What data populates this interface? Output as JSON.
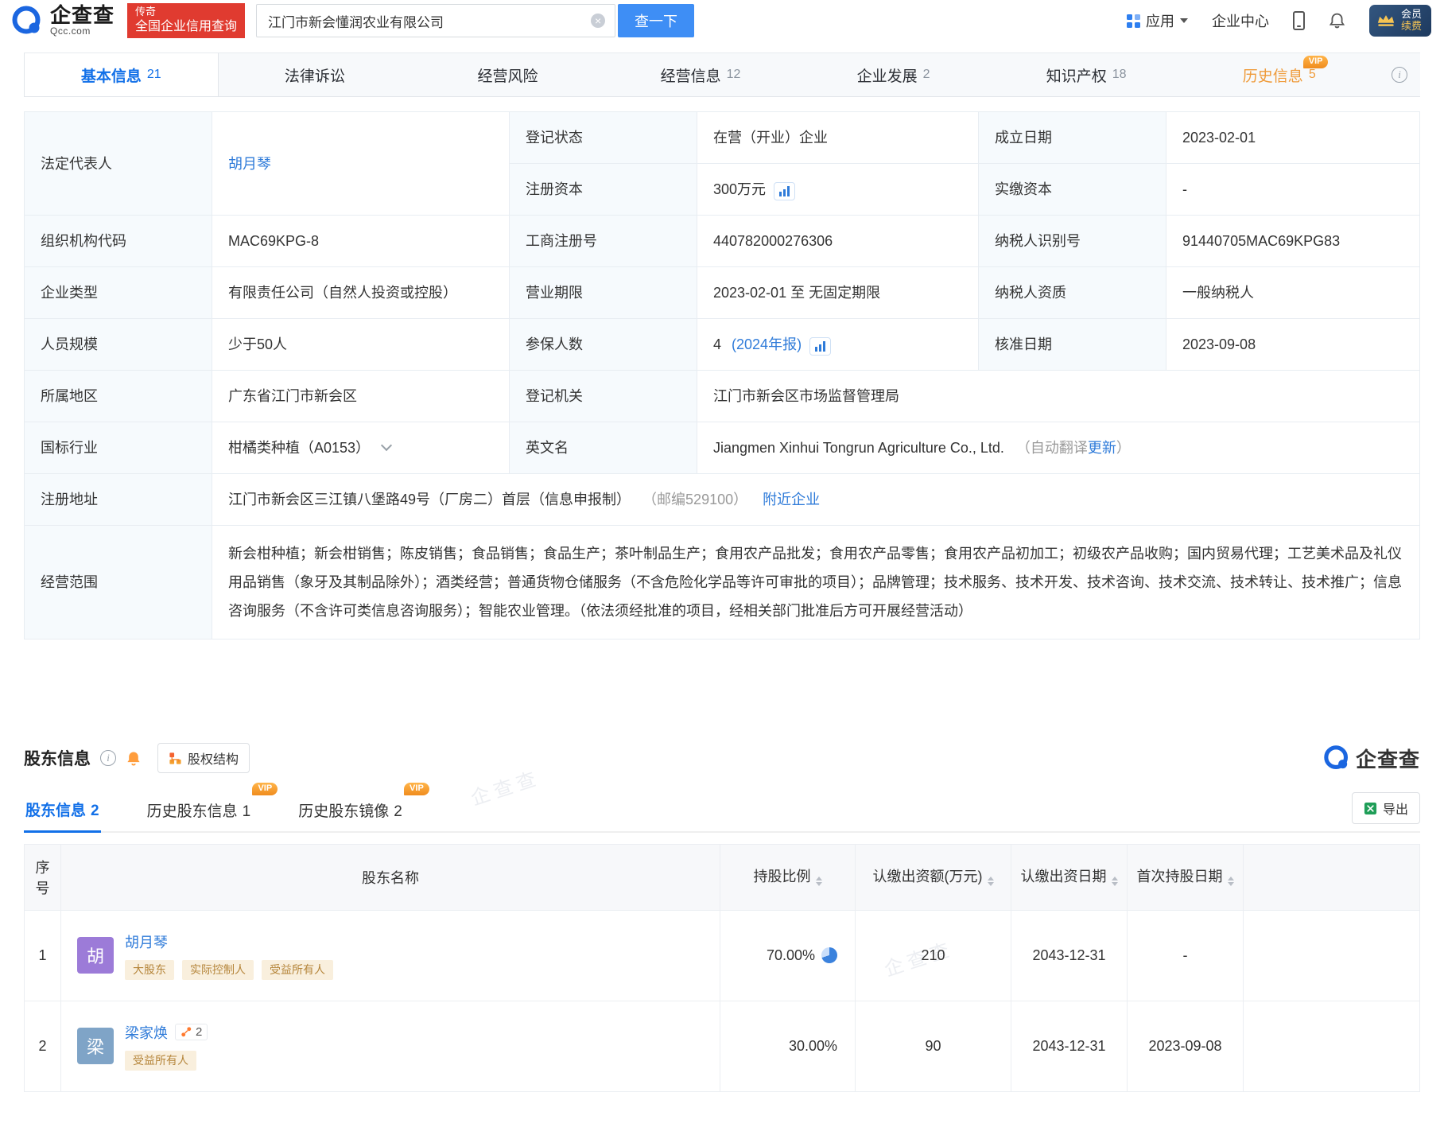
{
  "header": {
    "brand": {
      "name": "企查查",
      "domain": "Qcc.com"
    },
    "promo": {
      "line1": "传奇",
      "line2": "全国企业信用查询"
    },
    "search": {
      "value": "江门市新会懂润农业有限公司",
      "button": "查一下"
    },
    "nav": {
      "apps": "应用",
      "enterprise_center": "企业中心",
      "vip_top": "会员",
      "vip_bottom": "续费"
    }
  },
  "tabs": [
    {
      "label": "基本信息",
      "count": "21"
    },
    {
      "label": "法律诉讼",
      "count": ""
    },
    {
      "label": "经营风险",
      "count": ""
    },
    {
      "label": "经营信息",
      "count": "12"
    },
    {
      "label": "企业发展",
      "count": "2"
    },
    {
      "label": "知识产权",
      "count": "18"
    },
    {
      "label": "历史信息",
      "count": "5",
      "vip": "VIP"
    }
  ],
  "info": {
    "legal_rep": {
      "label": "法定代表人",
      "value": "胡月琴"
    },
    "reg_status": {
      "label": "登记状态",
      "value": "在营（开业）企业"
    },
    "est_date": {
      "label": "成立日期",
      "value": "2023-02-01"
    },
    "reg_capital": {
      "label": "注册资本",
      "value": "300万元"
    },
    "paid_capital": {
      "label": "实缴资本",
      "value": "-"
    },
    "org_code": {
      "label": "组织机构代码",
      "value": "MAC69KPG-8"
    },
    "reg_no": {
      "label": "工商注册号",
      "value": "440782000276306"
    },
    "taxpayer_id": {
      "label": "纳税人识别号",
      "value": "91440705MAC69KPG83"
    },
    "company_type": {
      "label": "企业类型",
      "value": "有限责任公司（自然人投资或控股）"
    },
    "business_term": {
      "label": "营业期限",
      "value": "2023-02-01 至 无固定期限"
    },
    "taxpayer_quality": {
      "label": "纳税人资质",
      "value": "一般纳税人"
    },
    "staff_size": {
      "label": "人员规模",
      "value": "少于50人"
    },
    "insured": {
      "label": "参保人数",
      "value": "4",
      "report": "(2024年报)"
    },
    "approval_date": {
      "label": "核准日期",
      "value": "2023-09-08"
    },
    "region": {
      "label": "所属地区",
      "value": "广东省江门市新会区"
    },
    "reg_authority": {
      "label": "登记机关",
      "value": "江门市新会区市场监督管理局"
    },
    "industry": {
      "label": "国标行业",
      "value": "柑橘类种植（A0153）"
    },
    "english_name": {
      "label": "英文名",
      "value": "Jiangmen Xinhui Tongrun Agriculture Co., Ltd.",
      "note_prefix": "（自动翻译",
      "note_link": "更新",
      "note_suffix": "）"
    },
    "reg_address": {
      "label": "注册地址",
      "value": "江门市新会区三江镇八堡路49号（厂房二）首层（信息申报制）",
      "postcode": "（邮编529100）",
      "nearby": "附近企业"
    },
    "business_scope": {
      "label": "经营范围",
      "value": "新会柑种植；新会柑销售；陈皮销售；食品销售；食品生产；茶叶制品生产；食用农产品批发；食用农产品零售；食用农产品初加工；初级农产品收购；国内贸易代理；工艺美术品及礼仪用品销售（象牙及其制品除外）；酒类经营；普通货物仓储服务（不含危险化学品等许可审批的项目）；品牌管理；技术服务、技术开发、技术咨询、技术交流、技术转让、技术推广；信息咨询服务（不含许可类信息咨询服务）；智能农业管理。（依法须经批准的项目，经相关部门批准后方可开展经营活动）"
    }
  },
  "shareholders": {
    "title": "股东信息",
    "equity_structure": "股权结构",
    "brand": "企查查",
    "tabs": [
      {
        "label": "股东信息",
        "count": "2"
      },
      {
        "label": "历史股东信息",
        "count": "1",
        "vip": "VIP"
      },
      {
        "label": "历史股东镜像",
        "count": "2",
        "vip": "VIP"
      }
    ],
    "export": "导出",
    "columns": [
      "序号",
      "股东名称",
      "持股比例",
      "认缴出资额(万元)",
      "认缴出资日期",
      "首次持股日期"
    ],
    "rows": [
      {
        "no": "1",
        "avatar": "胡",
        "name": "胡月琴",
        "tags": [
          "大股东",
          "实际控制人",
          "受益所有人"
        ],
        "ratio": "70.00%",
        "amount": "210",
        "subscribe_date": "2043-12-31",
        "first_date": "-"
      },
      {
        "no": "2",
        "avatar": "梁",
        "name": "梁家焕",
        "link_count": "2",
        "tags": [
          "受益所有人"
        ],
        "ratio": "30.00%",
        "amount": "90",
        "subscribe_date": "2043-12-31",
        "first_date": "2023-09-08"
      }
    ]
  },
  "misc": {
    "watermark": "企查查"
  },
  "colors": {
    "brand_blue": "#1b66e0",
    "link_blue": "#2f7bd9",
    "active_tab_blue": "#1270e8",
    "promo_red": "#e03b30",
    "vip_orange": "#f5a623",
    "tag_bg": "#f9efdd",
    "tag_text": "#b5853a",
    "avatar_purple": "#9c7bd8",
    "avatar_blue": "#7fa4c7",
    "search_button_blue": "#3e8ef5"
  }
}
